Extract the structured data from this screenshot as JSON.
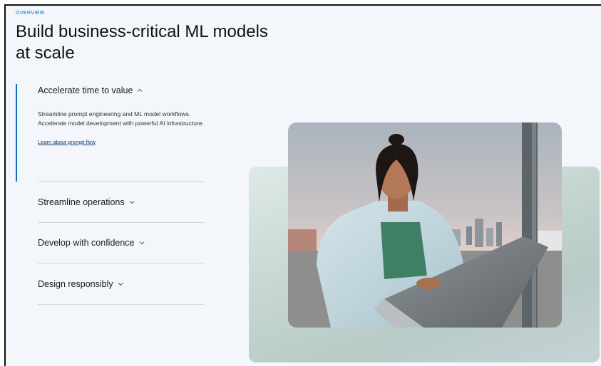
{
  "header": {
    "eyebrow": "OVERVIEW",
    "title": "Build business-critical ML models at scale"
  },
  "accordion": {
    "items": [
      {
        "label": "Accelerate time to value",
        "expanded": true,
        "body": "Streamline prompt engineering and ML model workflows. Accelerate model development with powerful AI infrastructure.",
        "link": "Learn about prompt flow"
      },
      {
        "label": "Streamline operations",
        "expanded": false
      },
      {
        "label": "Develop with confidence",
        "expanded": false
      },
      {
        "label": "Design responsibly",
        "expanded": false
      }
    ]
  },
  "colors": {
    "accent": "#0f6cbd",
    "panel_bg": "#f3f7fb"
  },
  "icons": {
    "expanded": "chevron-up-icon",
    "collapsed": "chevron-down-icon"
  }
}
